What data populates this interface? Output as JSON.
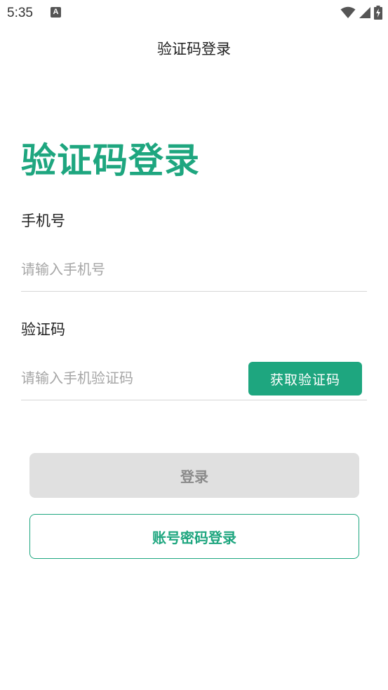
{
  "status_bar": {
    "time": "5:35",
    "notification_icon": "text-a-icon",
    "notification_glyph": "A",
    "icons": [
      "wifi-icon",
      "signal-icon",
      "battery-charging-icon"
    ]
  },
  "header": {
    "title": "验证码登录"
  },
  "main": {
    "heading": "验证码登录",
    "phone_label": "手机号",
    "phone_placeholder": "请输入手机号",
    "phone_value": "",
    "code_label": "验证码",
    "code_placeholder": "请输入手机验证码",
    "code_value": "",
    "get_code_label": "获取验证码",
    "login_label": "登录",
    "account_login_label": "账号密码登录"
  },
  "colors": {
    "accent": "#1ea67f",
    "disabled_button": "#e0e0e0",
    "disabled_text": "#8a8a8a",
    "placeholder": "#a6a6a6",
    "divider": "#d6d6d6"
  }
}
